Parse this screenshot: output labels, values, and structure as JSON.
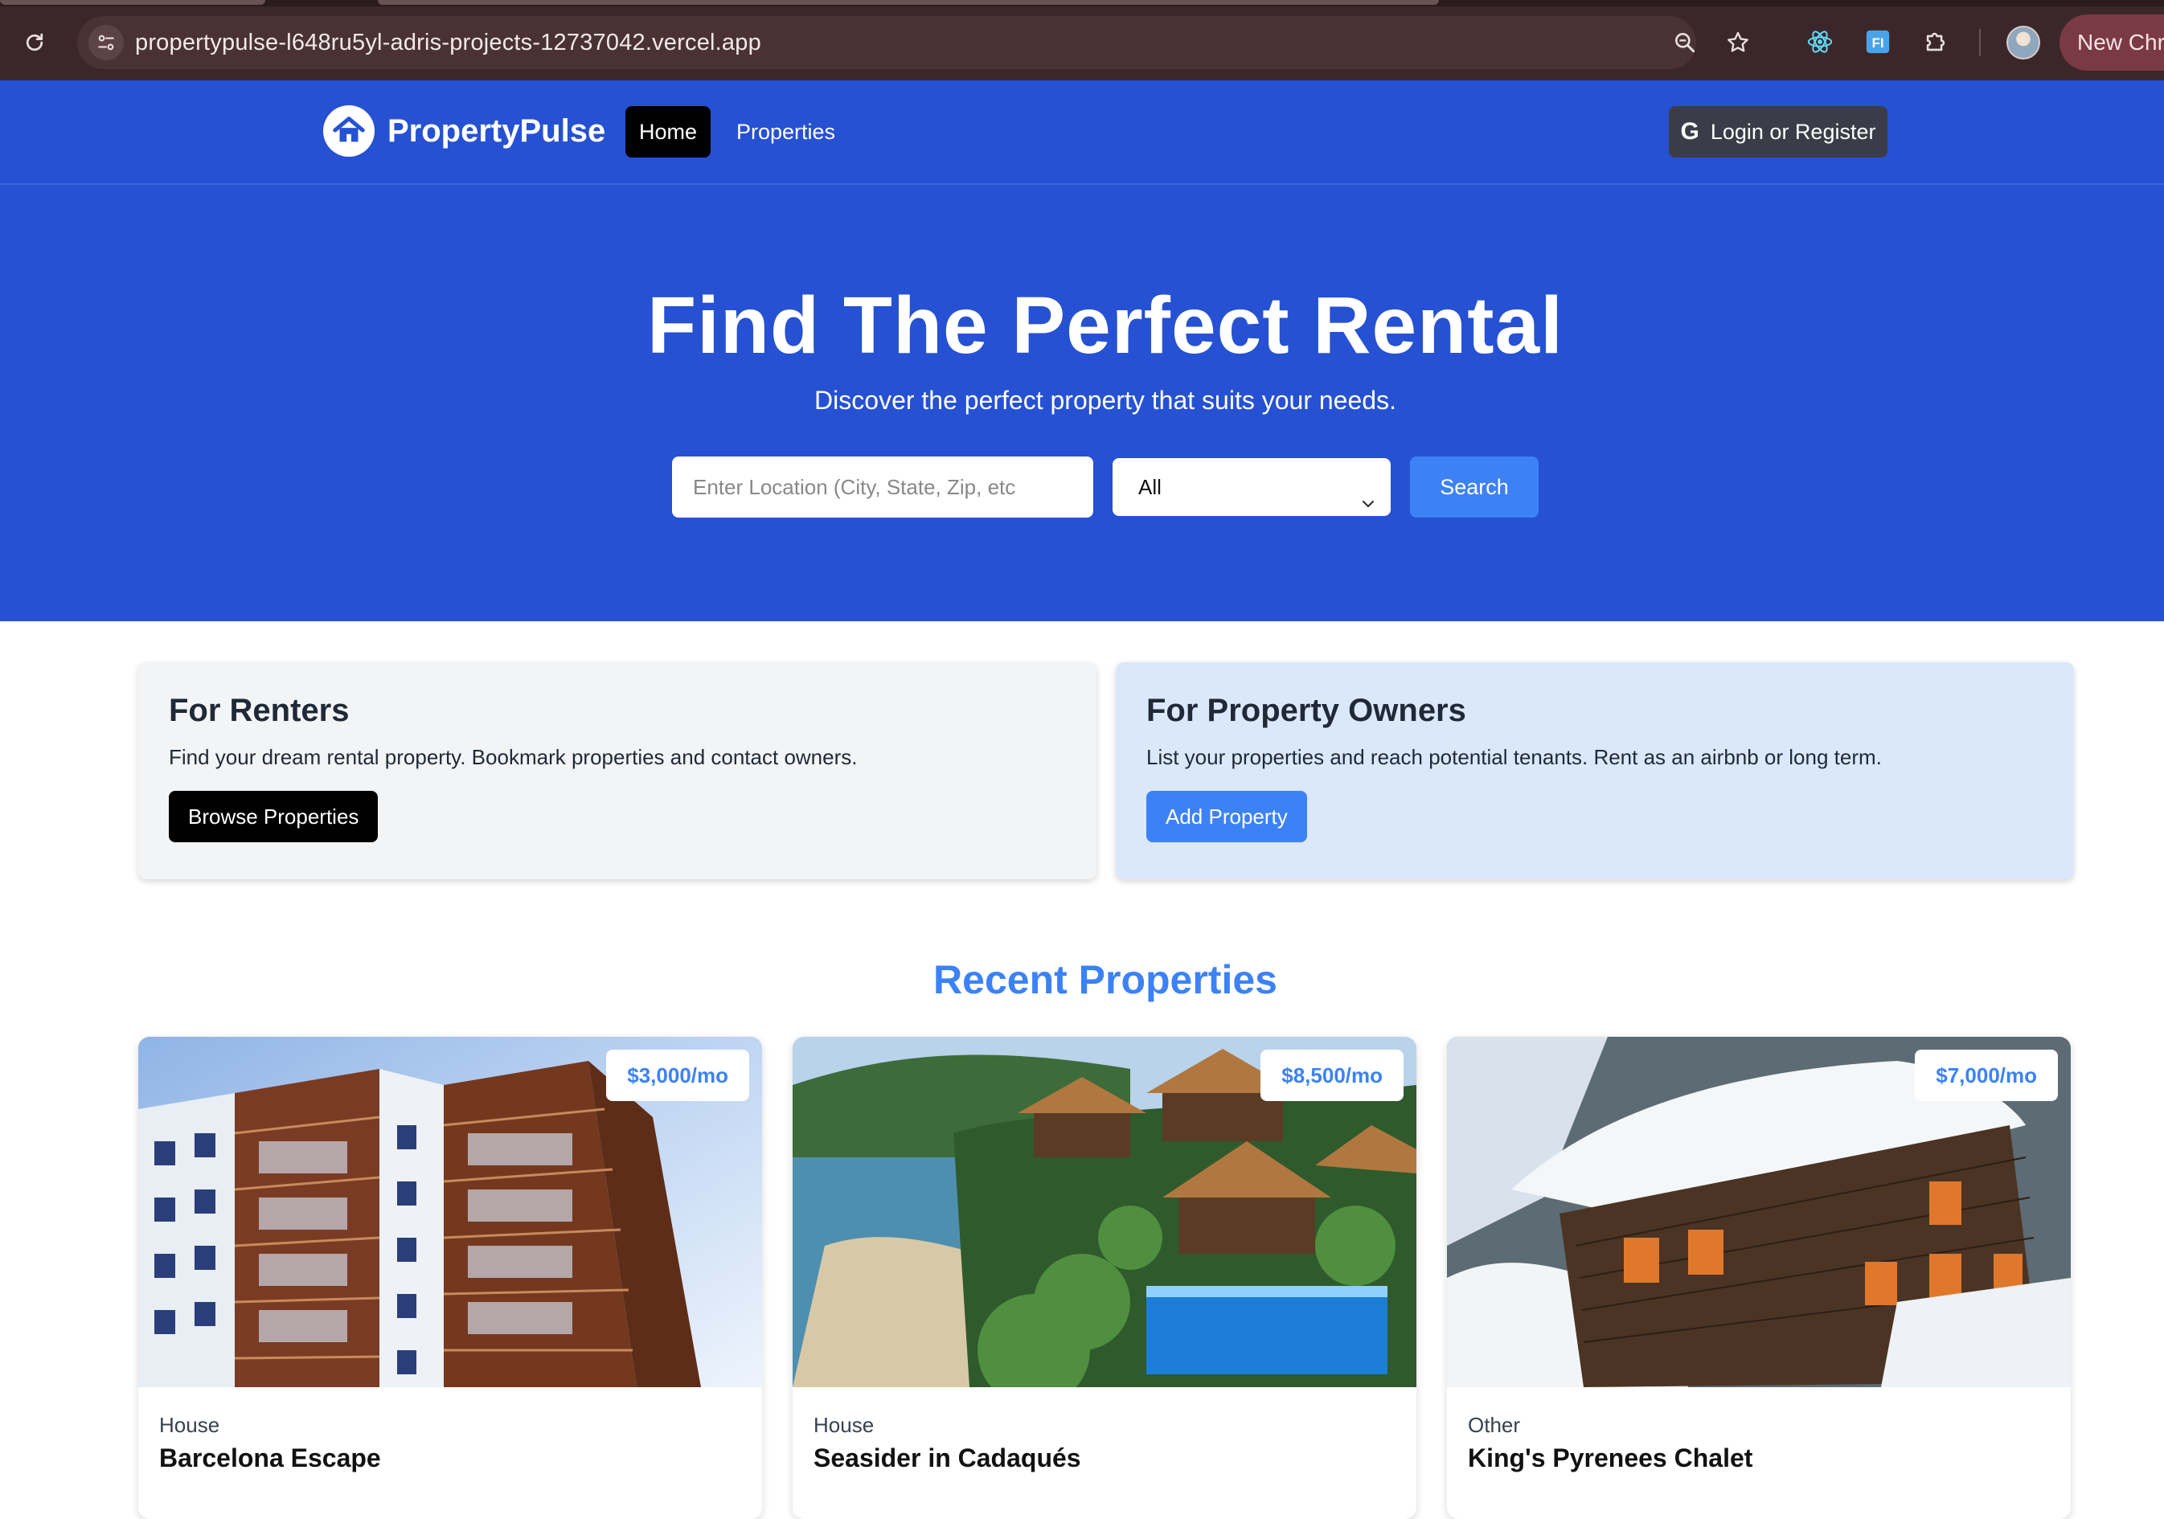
{
  "browser": {
    "url": "propertypulse-l648ru5yl-adris-projects-12737042.vercel.app",
    "new_chrome_label": "New Chro",
    "icons": [
      "reload-icon",
      "site-info-icon",
      "zoom-icon",
      "bookmark-star-icon",
      "react-devtools-icon",
      "extension-ft-icon",
      "extensions-puzzle-icon"
    ]
  },
  "nav": {
    "brand": "PropertyPulse",
    "home": "Home",
    "properties": "Properties",
    "login": "Login or Register",
    "login_icon": "G"
  },
  "hero": {
    "title": "Find The Perfect Rental",
    "subtitle": "Discover the perfect property that suits your needs.",
    "search_placeholder": "Enter Location (City, State, Zip, etc",
    "type_selected": "All",
    "search_button": "Search"
  },
  "info": {
    "renters": {
      "title": "For Renters",
      "text": "Find your dream rental property. Bookmark properties and contact owners.",
      "button": "Browse Properties"
    },
    "owners": {
      "title": "For Property Owners",
      "text": "List your properties and reach potential tenants. Rent as an airbnb or long term.",
      "button": "Add Property"
    }
  },
  "recent": {
    "title": "Recent Properties",
    "cards": [
      {
        "price": "$3,000/mo",
        "type": "House",
        "name": "Barcelona Escape"
      },
      {
        "price": "$8,500/mo",
        "type": "House",
        "name": "Seasider in Cadaqués"
      },
      {
        "price": "$7,000/mo",
        "type": "Other",
        "name": "King's Pyrenees Chalet"
      }
    ]
  },
  "colors": {
    "primary_blue": "#2651d2",
    "accent_blue": "#3c82f6",
    "chrome_bg": "#3b2729"
  }
}
